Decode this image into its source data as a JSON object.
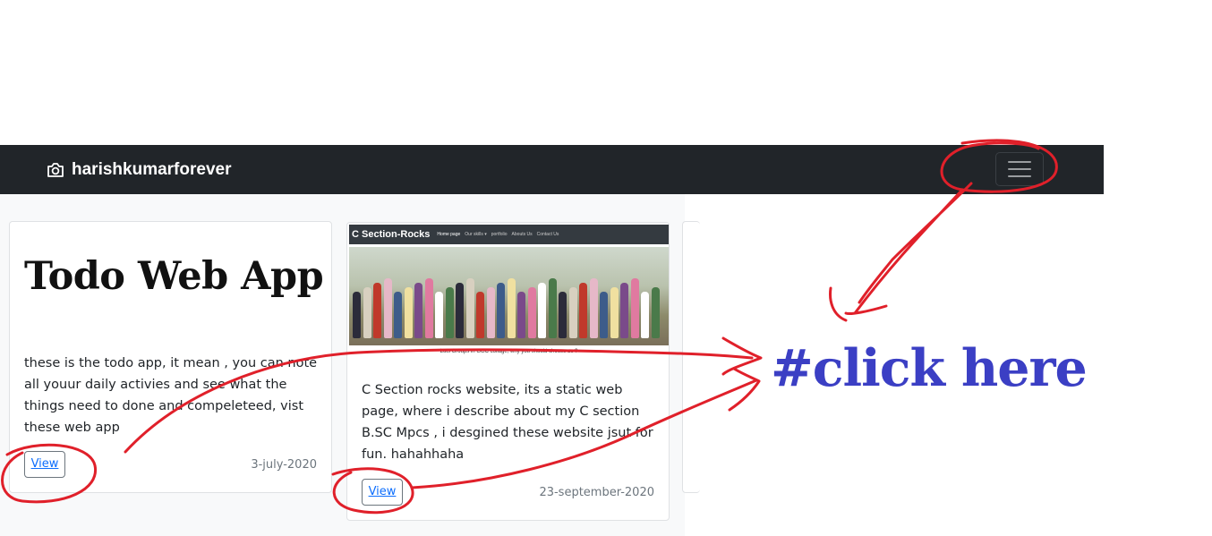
{
  "navbar": {
    "brand": "harishkumarforever",
    "brand_icon": "camera-icon",
    "toggler_icon": "hamburger-menu-icon"
  },
  "cards": [
    {
      "title": "Todo Web App",
      "text": "these is the todo app, it mean , you can note all youur daily activies and see what the things need to done and compeleteed, vist these web app",
      "button": "View",
      "date": "3-july-2020"
    },
    {
      "image": {
        "brand": "C Section-Rocks",
        "links": [
          "Home page",
          "Our skills ▾",
          "portfolio",
          "Abouts Us",
          "Contact Us"
        ],
        "caption": "Lots Groups in GGC collage, why you should choose us ?"
      },
      "text": "C Section rocks website, its a static web page, where i describe about my C section B.SC Mpcs , i desgined these website jsut for fun. hahahhaha",
      "button": "View",
      "date": "23-september-2020"
    }
  ],
  "annotation": {
    "label": "#click here",
    "color": "#e0202a"
  }
}
